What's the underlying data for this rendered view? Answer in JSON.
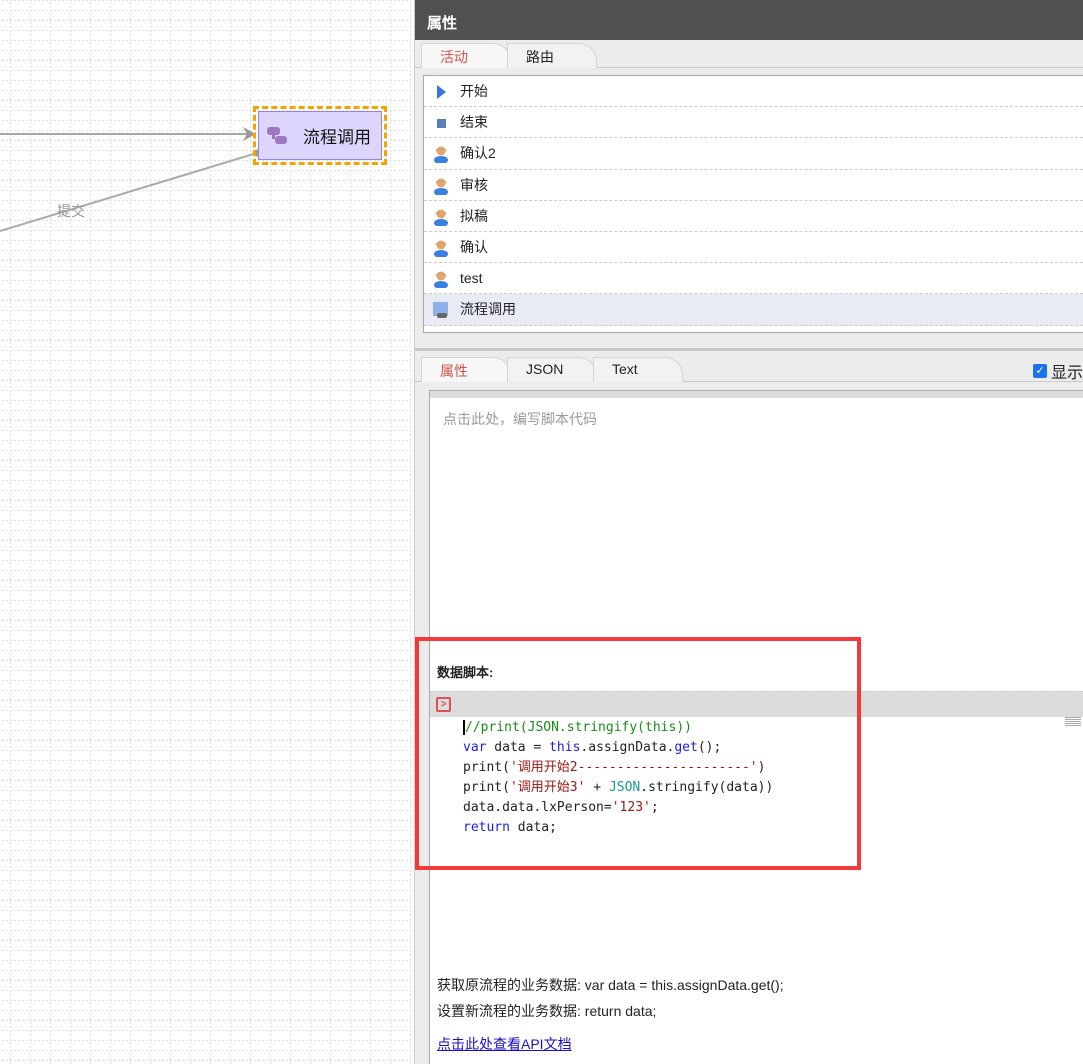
{
  "canvas": {
    "node_label": "流程调用",
    "edge_label": "提交",
    "colors": {
      "selection": "#f5a300",
      "node_fill": "#ddd5fb"
    }
  },
  "panel": {
    "title": "属性",
    "top_tabs": [
      {
        "label": "活动",
        "active": true
      },
      {
        "label": "路由",
        "active": false
      }
    ],
    "activities": [
      {
        "label": "开始",
        "icon": "start-triangle-icon"
      },
      {
        "label": "结束",
        "icon": "end-square-icon"
      },
      {
        "label": "确认2",
        "icon": "user-icon"
      },
      {
        "label": "审核",
        "icon": "user-icon"
      },
      {
        "label": "拟稿",
        "icon": "user-icon"
      },
      {
        "label": "确认",
        "icon": "user-icon"
      },
      {
        "label": "test",
        "icon": "user-icon"
      },
      {
        "label": "流程调用",
        "icon": "subprocess-icon",
        "selected": true
      }
    ],
    "bottom_tabs": [
      {
        "label": "属性",
        "active": true
      },
      {
        "label": "JSON",
        "active": false
      },
      {
        "label": "Text",
        "active": false
      }
    ],
    "show_checkbox": {
      "label": "显示",
      "checked": true
    },
    "script_placeholder": "点击此处，编写脚本代码",
    "data_script_label": "数据脚本:",
    "code_lines": {
      "l1": "//print(JSON.stringify(this))",
      "l2a": "var",
      " l2b": " data = ",
      "l2c": "this",
      "l2d": ".assignData.",
      "l2e": "get",
      "l2f": "();",
      "l3a": "print(",
      "l3b": "'调用开始2----------------------'",
      "l3c": ")",
      "l4a": "print(",
      "l4b": "'调用开始3'",
      "l4c": " + ",
      "l4d": "JSON",
      "l4e": ".stringify(data))",
      "l5a": "data.data.lxPerson=",
      "l5b": "'123'",
      "l5c": ";",
      "l6a": "return",
      "l6b": " data;"
    },
    "note1": "获取原流程的业务数据: var data = this.assignData.get();",
    "note2": "设置新流程的业务数据: return data;",
    "api_link": "点击此处查看API文档"
  }
}
